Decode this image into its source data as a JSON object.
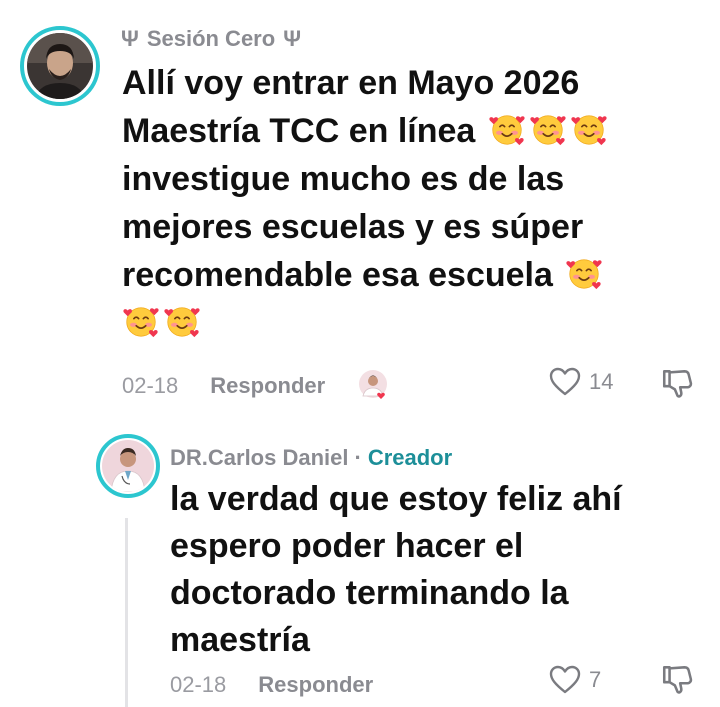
{
  "comment": {
    "username": "Sesión Cero",
    "username_prefix_symbol": "Ψ",
    "username_suffix_symbol": "Ψ",
    "text_line1": "Allí voy entrar en Mayo 2026",
    "text_line2": "Maestría TCC en línea",
    "text_line3": "investigue mucho es de las",
    "text_line4": "mejores escuelas y es súper",
    "text_line5": "recomendable esa escuela",
    "emoji_name": "smiling-face-with-hearts",
    "date": "02-18",
    "reply_label": "Responder",
    "like_count": "14"
  },
  "reply": {
    "username": "DR.Carlos Daniel",
    "separator": "·",
    "creator_badge": "Creador",
    "text_line1": "la verdad que estoy feliz ahí",
    "text_line2": "espero poder hacer el",
    "text_line3": "doctorado terminando la",
    "text_line4": "maestría",
    "date": "02-18",
    "reply_label": "Responder",
    "like_count": "7"
  },
  "colors": {
    "avatar_ring": "#2cc6cf",
    "creator_badge": "#1d8f99",
    "muted_text": "#8a8b91",
    "heart_accent": "#f0364f"
  }
}
